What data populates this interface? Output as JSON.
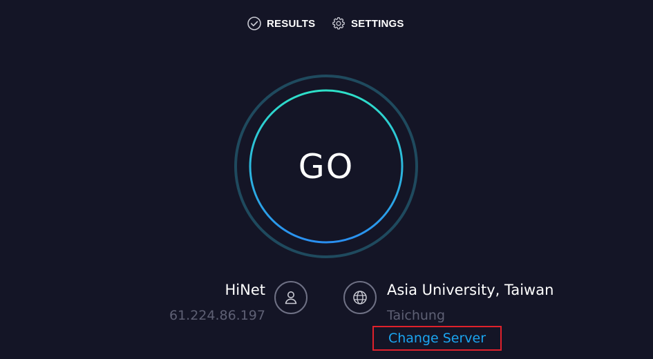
{
  "nav": {
    "results_label": "RESULTS",
    "results_icon": "check-circle-icon",
    "settings_label": "SETTINGS",
    "settings_icon": "gear-icon"
  },
  "go_button": {
    "label": "GO"
  },
  "isp": {
    "name": "HiNet",
    "ip": "61.224.86.197",
    "icon": "user-icon"
  },
  "server": {
    "name": "Asia University, Taiwan",
    "city": "Taichung",
    "icon": "globe-icon",
    "change_label": "Change Server"
  },
  "colors": {
    "background": "#141526",
    "ring_outer": "#1f4a5e",
    "ring_gradient_top": "#2ee0c8",
    "ring_gradient_bottom": "#2a8ff0",
    "muted_text": "#5e6074",
    "link": "#1ba5f0",
    "highlight_box": "#e0212b"
  }
}
